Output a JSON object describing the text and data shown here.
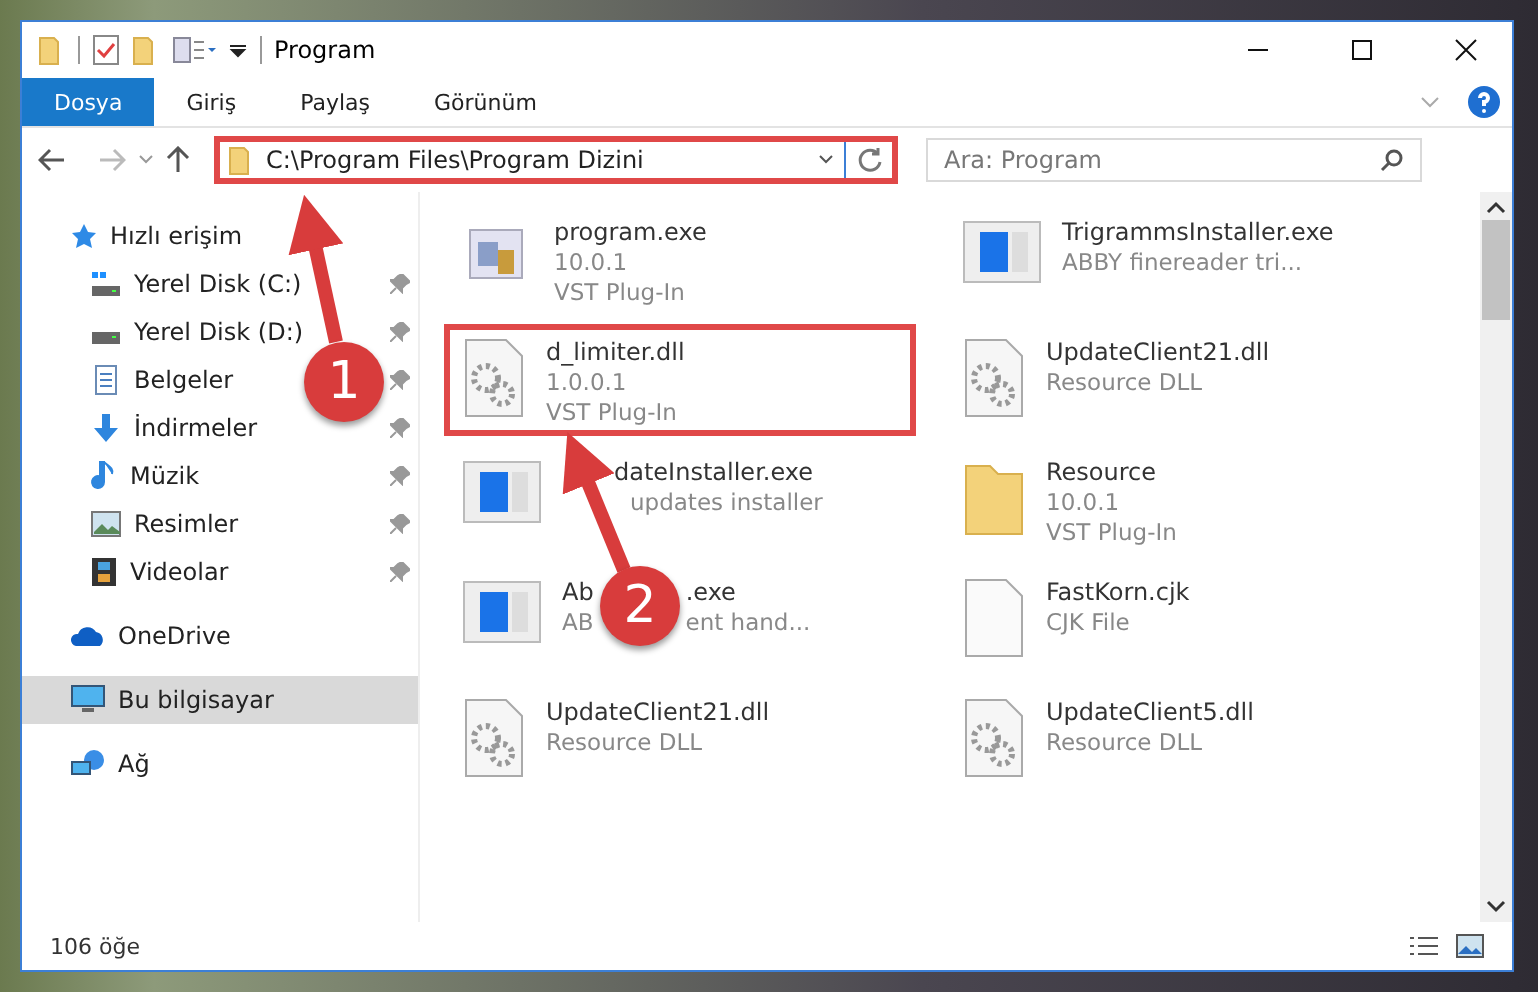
{
  "window": {
    "title": "Program"
  },
  "ribbon_tabs": [
    {
      "label": "Dosya",
      "kind": "file"
    },
    {
      "label": "Giriş",
      "kind": "tab"
    },
    {
      "label": "Paylaş",
      "kind": "tab"
    },
    {
      "label": "Görünüm",
      "kind": "tab"
    }
  ],
  "address_bar": {
    "path": "C:\\Program Files\\Program Dizini"
  },
  "search": {
    "placeholder": "Ara: Program"
  },
  "sidebar": {
    "items": [
      {
        "label": "Hızlı erişim",
        "kind": "star",
        "selected": false,
        "children": [
          {
            "label": "Yerel Disk (C:)",
            "kind": "drive-c",
            "pinned": true,
            "selected": false
          },
          {
            "label": "Yerel Disk (D:)",
            "kind": "drive",
            "pinned": true,
            "selected": false
          },
          {
            "label": "Belgeler",
            "kind": "docs",
            "pinned": true,
            "selected": false
          },
          {
            "label": "İndirmeler",
            "kind": "download",
            "pinned": true,
            "selected": false
          },
          {
            "label": "Müzik",
            "kind": "music",
            "pinned": true,
            "selected": false
          },
          {
            "label": "Resimler",
            "kind": "pictures",
            "pinned": true,
            "selected": false
          },
          {
            "label": "Videolar",
            "kind": "video",
            "pinned": true,
            "selected": false
          }
        ]
      },
      {
        "label": "OneDrive",
        "kind": "cloud",
        "selected": false
      },
      {
        "label": "Bu bilgisayar",
        "kind": "computer",
        "selected": true
      },
      {
        "label": "Ağ",
        "kind": "network",
        "selected": false
      }
    ]
  },
  "files": [
    {
      "name": "program.exe",
      "details": [
        "10.0.1",
        "VST Plug-In"
      ],
      "kind": "app",
      "highlighted": false
    },
    {
      "name": "TrigrammsInstaller.exe",
      "details": [
        "ABBY finereader tri..."
      ],
      "kind": "window",
      "highlighted": false
    },
    {
      "name": "d_limiter.dll",
      "details": [
        "1.0.0.1",
        "VST Plug-In"
      ],
      "kind": "gear-doc",
      "highlighted": true
    },
    {
      "name": "UpdateClient21.dll",
      "details": [
        "Resource DLL"
      ],
      "kind": "gear-doc",
      "highlighted": false
    },
    {
      "name": "dateInstaller.exe",
      "details": [
        "updates installer"
      ],
      "kind": "window",
      "highlighted": false
    },
    {
      "name": "Resource",
      "details": [
        "10.0.1",
        "VST Plug-In"
      ],
      "kind": "folder",
      "highlighted": false
    },
    {
      "name": [
        "Ab",
        ".exe"
      ],
      "details": [
        [
          "AB",
          "ent hand..."
        ]
      ],
      "kind": "window",
      "highlighted": false
    },
    {
      "name": "FastKorn.cjk",
      "details": [
        "CJK File"
      ],
      "kind": "doc",
      "highlighted": false
    },
    {
      "name": "UpdateClient21.dll",
      "details": [
        "Resource DLL"
      ],
      "kind": "gear-doc",
      "highlighted": false
    },
    {
      "name": "UpdateClient5.dll",
      "details": [
        "Resource DLL"
      ],
      "kind": "gear-doc",
      "highlighted": false
    }
  ],
  "status_bar": {
    "item_count": "106 öğe"
  },
  "callouts": [
    {
      "number": "1"
    },
    {
      "number": "2"
    }
  ]
}
